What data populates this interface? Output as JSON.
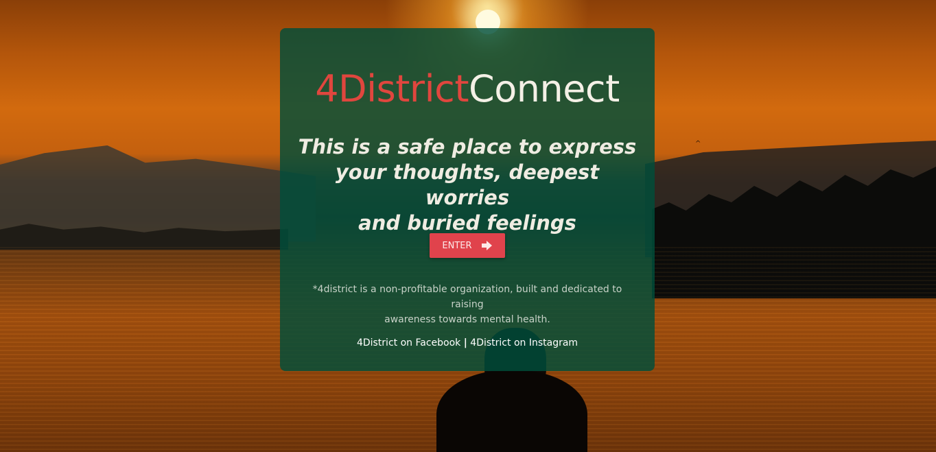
{
  "brand": {
    "part1": "4District",
    "part2": "Connect",
    "colors": {
      "part1": "#e0463e",
      "part2": "#f4f0e6"
    }
  },
  "tagline": {
    "line1": "This is a safe place to express",
    "line2": "your thoughts, deepest worries",
    "line3": "and buried feelings"
  },
  "enter_button": {
    "label": "ENTER",
    "icon": "arrow-right-icon",
    "color": "#e0434c"
  },
  "disclaimer": {
    "line1": "*4district is a non-profitable organization, built and dedicated to raising",
    "line2": "awareness towards mental health."
  },
  "links": {
    "facebook": "4District on Facebook",
    "separator": "|",
    "instagram": "4District on Instagram"
  },
  "card": {
    "color": "#004e3a"
  }
}
